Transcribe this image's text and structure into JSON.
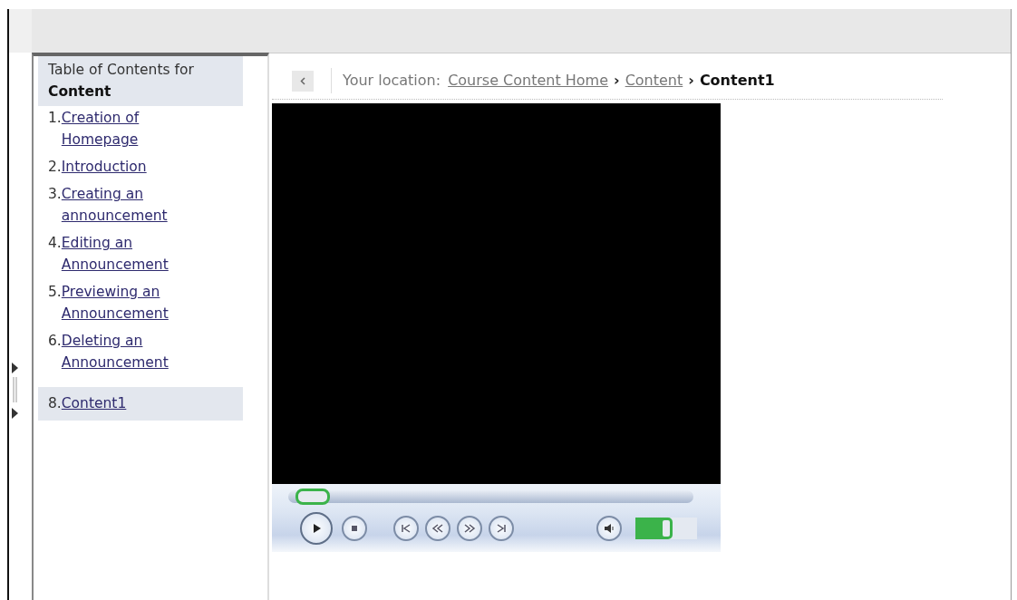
{
  "sidebar": {
    "title": "Table of Contents for",
    "subtitle": "Content",
    "items": [
      {
        "number": "1.",
        "label": "Creation of Homepage",
        "selected": false
      },
      {
        "number": "2.",
        "label": "Introduction",
        "selected": false
      },
      {
        "number": "3.",
        "label": "Creating an announcement",
        "selected": false
      },
      {
        "number": "4.",
        "label": "Editing an Announcement",
        "selected": false
      },
      {
        "number": "5.",
        "label": "Previewing an Announcement",
        "selected": false
      },
      {
        "number": "6.",
        "label": "Deleting an Announcement",
        "selected": false
      },
      {
        "number": "8.",
        "label": "Content1",
        "selected": true
      }
    ]
  },
  "breadcrumb": {
    "prefix": "Your location:",
    "items": [
      {
        "label": "Course Content Home",
        "kind": "link"
      },
      {
        "separator": "›",
        "label": "Content",
        "kind": "link"
      },
      {
        "separator": "›",
        "label": "Content1",
        "kind": "current"
      }
    ]
  },
  "player": {
    "seek": {
      "level": 0.02
    },
    "volume": {
      "level": 0.5
    }
  }
}
